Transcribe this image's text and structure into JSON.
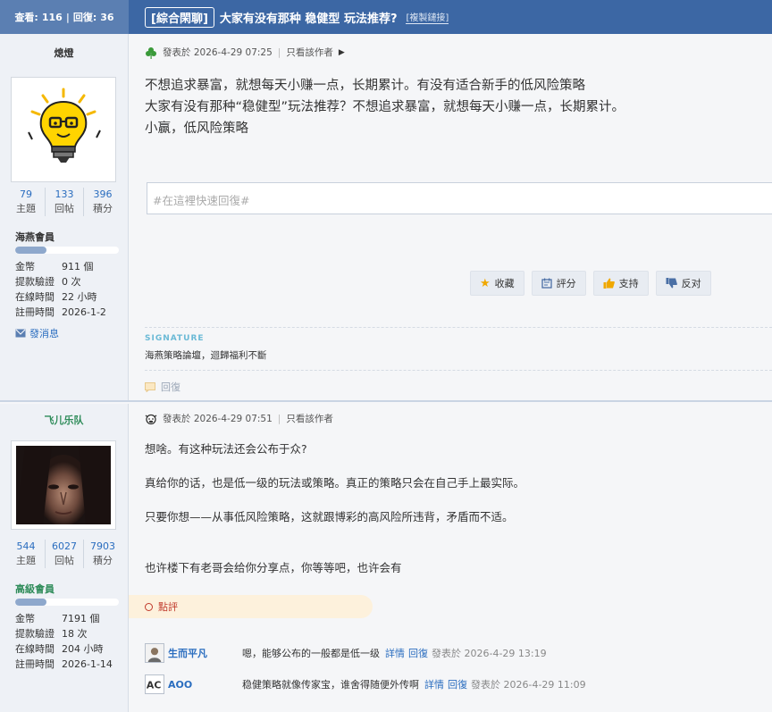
{
  "top": {
    "views_label": "查看:",
    "views": "116",
    "replies_label": "回復:",
    "replies": "36",
    "category": "[綜合閑聊]",
    "title": "大家有没有那种 稳健型 玩法推荐?",
    "copy_link": "[複製鏈接]"
  },
  "post1": {
    "author": "熄燈",
    "stats": [
      {
        "num": "79",
        "label": "主題"
      },
      {
        "num": "133",
        "label": "回帖"
      },
      {
        "num": "396",
        "label": "積分"
      }
    ],
    "level": "海燕會員",
    "level_progress": 0.3,
    "info": [
      {
        "k": "金幣",
        "v": "911 個"
      },
      {
        "k": "提款驗證",
        "v": "0 次"
      },
      {
        "k": "在線時間",
        "v": "22 小時"
      },
      {
        "k": "註冊時間",
        "v": "2026-1-2"
      }
    ],
    "send_msg": "發消息",
    "meta_posted": "發表於 2026-4-29 07:25",
    "meta_only_author": "只看該作者",
    "lines": [
      "不想追求暴富，就想每天小赚一点，长期累计。有没有适合新手的低风险策略",
      "大家有没有那种“稳健型”玩法推荐？不想追求暴富，就想每天小赚一点，长期累计。",
      "小赢，低风险策略"
    ],
    "quick_reply_placeholder": "#在這裡快速回復#",
    "actions": [
      {
        "label": "收藏",
        "icon": "star-icon"
      },
      {
        "label": "評分",
        "icon": "rating-icon"
      },
      {
        "label": "支持",
        "icon": "thumb-up-icon"
      },
      {
        "label": "反对",
        "icon": "thumb-down-icon"
      }
    ],
    "signature_label": "SIGNATURE",
    "signature": "海燕策略論壇，迴歸福利不斷",
    "reply": "回復"
  },
  "post2": {
    "author": "飞儿乐队",
    "stats": [
      {
        "num": "544",
        "label": "主題"
      },
      {
        "num": "6027",
        "label": "回帖"
      },
      {
        "num": "7903",
        "label": "積分"
      }
    ],
    "level": "高級會員",
    "level_progress": 0.3,
    "info": [
      {
        "k": "金幣",
        "v": "7191 個"
      },
      {
        "k": "提款驗證",
        "v": "18 次"
      },
      {
        "k": "在線時間",
        "v": "204 小時"
      },
      {
        "k": "註冊時間",
        "v": "2026-1-14"
      }
    ],
    "meta_posted": "發表於 2026-4-29 07:51",
    "meta_only_author": "只看該作者",
    "paragraphs": [
      "想啥。有这种玩法还会公布于众?",
      "真给你的话，也是低一级的玩法或策略。真正的策略只会在自己手上最实际。",
      "只要你想——从事低风险策略，这就跟博彩的高风险所违背，矛盾而不适。",
      "也许楼下有老哥会给你分享点，你等等吧，也许会有"
    ],
    "rate_label": "點評",
    "comments": [
      {
        "name": "生而平凡",
        "text": "嗯，能够公布的一般都是低一级",
        "detail": "詳情",
        "reply": "回復",
        "time": "發表於 2026-4-29 13:19"
      },
      {
        "name": "AOO",
        "text": "稳健策略就像传家宝，谁舍得随便外传啊",
        "detail": "詳情",
        "reply": "回復",
        "time": "發表於 2026-4-29 11:09"
      }
    ]
  }
}
